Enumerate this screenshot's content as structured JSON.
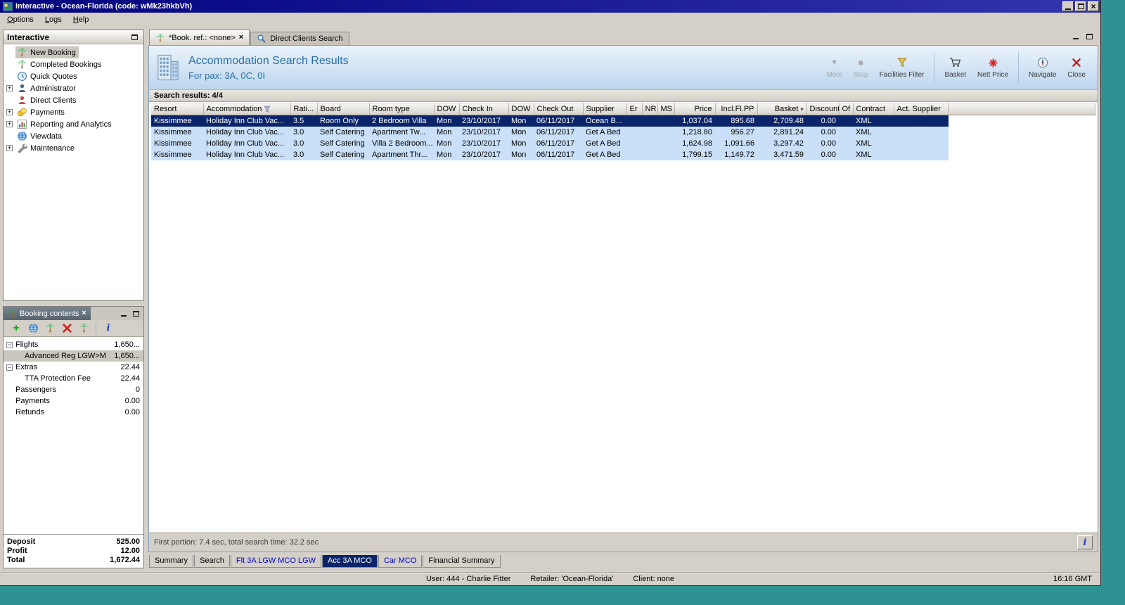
{
  "icons": {
    "close_x": "×",
    "more": "▼",
    "stop": "■",
    "plus": "+",
    "info": "i",
    "sort": "▾",
    "expand": "+",
    "collapse": "−"
  },
  "titlebar": {
    "title": "Interactive - Ocean-Florida (code: wMk23hkbVh)"
  },
  "menubar": {
    "items": [
      "Options",
      "Logs",
      "Help"
    ]
  },
  "sidebar": {
    "title": "Interactive",
    "items": [
      {
        "label": "New Booking"
      },
      {
        "label": "Completed Bookings"
      },
      {
        "label": "Quick Quotes"
      },
      {
        "label": "Administrator"
      },
      {
        "label": "Direct Clients"
      },
      {
        "label": "Payments"
      },
      {
        "label": "Reporting and Analytics"
      },
      {
        "label": "Viewdata"
      },
      {
        "label": "Maintenance"
      }
    ]
  },
  "booking_panel": {
    "title": "Booking contents",
    "rows": [
      {
        "label": "Flights",
        "value": "1,650..."
      },
      {
        "label": "Advanced Reg LGW>M",
        "value": "1,650..."
      },
      {
        "label": "Extras",
        "value": "22.44"
      },
      {
        "label": "TTA Protection Fee",
        "value": "22.44"
      },
      {
        "label": "Passengers",
        "value": "0"
      },
      {
        "label": "Payments",
        "value": "0.00"
      },
      {
        "label": "Refunds",
        "value": "0.00"
      }
    ],
    "summary": {
      "deposit_label": "Deposit",
      "deposit": "525.00",
      "profit_label": "Profit",
      "profit": "12.00",
      "total_label": "Total",
      "total": "1,672.44"
    }
  },
  "tabs": {
    "booking": "*Book. ref.: <none>",
    "direct_clients": "Direct Clients Search"
  },
  "results_header": {
    "title": "Accommodation Search Results",
    "subtitle": "For pax: 3A, 0C, 0I",
    "toolbar": [
      {
        "label": "More"
      },
      {
        "label": "Stop"
      },
      {
        "label": "Facilities Filter"
      },
      {
        "label": "Basket"
      },
      {
        "label": "Nett Price"
      },
      {
        "label": "Navigate"
      },
      {
        "label": "Close"
      }
    ]
  },
  "results": {
    "count_label": "Search results: 4/4",
    "columns": [
      "Resort",
      "Accommodation",
      "Rati...",
      "Board",
      "Room type",
      "DOW",
      "Check In",
      "DOW",
      "Check Out",
      "Supplier",
      "Er",
      "NR",
      "MS",
      "Price",
      "Incl.Fl.PP",
      "Basket",
      "Discount",
      "Of",
      "Contract",
      "Act. Supplier"
    ],
    "rows": [
      {
        "resort": "Kissimmee",
        "accommodation": "Holiday Inn Club Vac...",
        "rating": "3.5",
        "board": "Room Only",
        "room_type": "2 Bedroom Villa",
        "dow_in": "Mon",
        "check_in": "23/10/2017",
        "dow_out": "Mon",
        "check_out": "06/11/2017",
        "supplier": "Ocean B...",
        "er": "",
        "nr": "",
        "ms": "",
        "price": "1,037.04",
        "incl_fl_pp": "895.68",
        "basket": "2,709.48",
        "discount": "0.00",
        "of": "",
        "contract": "XML",
        "act_supplier": ""
      },
      {
        "resort": "Kissimmee",
        "accommodation": "Holiday Inn Club Vac...",
        "rating": "3.0",
        "board": "Self Catering",
        "room_type": "Apartment Tw...",
        "dow_in": "Mon",
        "check_in": "23/10/2017",
        "dow_out": "Mon",
        "check_out": "06/11/2017",
        "supplier": "Get A Bed",
        "er": "",
        "nr": "",
        "ms": "",
        "price": "1,218.80",
        "incl_fl_pp": "956.27",
        "basket": "2,891.24",
        "discount": "0.00",
        "of": "",
        "contract": "XML",
        "act_supplier": ""
      },
      {
        "resort": "Kissimmee",
        "accommodation": "Holiday Inn Club Vac...",
        "rating": "3.0",
        "board": "Self Catering",
        "room_type": "Villa 2 Bedroom...",
        "dow_in": "Mon",
        "check_in": "23/10/2017",
        "dow_out": "Mon",
        "check_out": "06/11/2017",
        "supplier": "Get A Bed",
        "er": "",
        "nr": "",
        "ms": "",
        "price": "1,624.98",
        "incl_fl_pp": "1,091.66",
        "basket": "3,297.42",
        "discount": "0.00",
        "of": "",
        "contract": "XML",
        "act_supplier": ""
      },
      {
        "resort": "Kissimmee",
        "accommodation": "Holiday Inn Club Vac...",
        "rating": "3.0",
        "board": "Self Catering",
        "room_type": "Apartment Thr...",
        "dow_in": "Mon",
        "check_in": "23/10/2017",
        "dow_out": "Mon",
        "check_out": "06/11/2017",
        "supplier": "Get A Bed",
        "er": "",
        "nr": "",
        "ms": "",
        "price": "1,799.15",
        "incl_fl_pp": "1,149.72",
        "basket": "3,471.59",
        "discount": "0.00",
        "of": "",
        "contract": "XML",
        "act_supplier": ""
      }
    ],
    "status": "First portion: 7.4 sec, total search time: 32.2 sec"
  },
  "bottom_tabs": [
    {
      "label": "Summary"
    },
    {
      "label": "Search"
    },
    {
      "label": "Flt 3A LGW MCO LGW"
    },
    {
      "label": "Acc 3A MCO"
    },
    {
      "label": "Car MCO"
    },
    {
      "label": "Financial Summary"
    }
  ],
  "statusbar": {
    "user": "User: 444 - Charlie Fitter",
    "retailer": "Retailer: 'Ocean-Florida'",
    "client": "Client: none",
    "time": "16:16 GMT"
  }
}
